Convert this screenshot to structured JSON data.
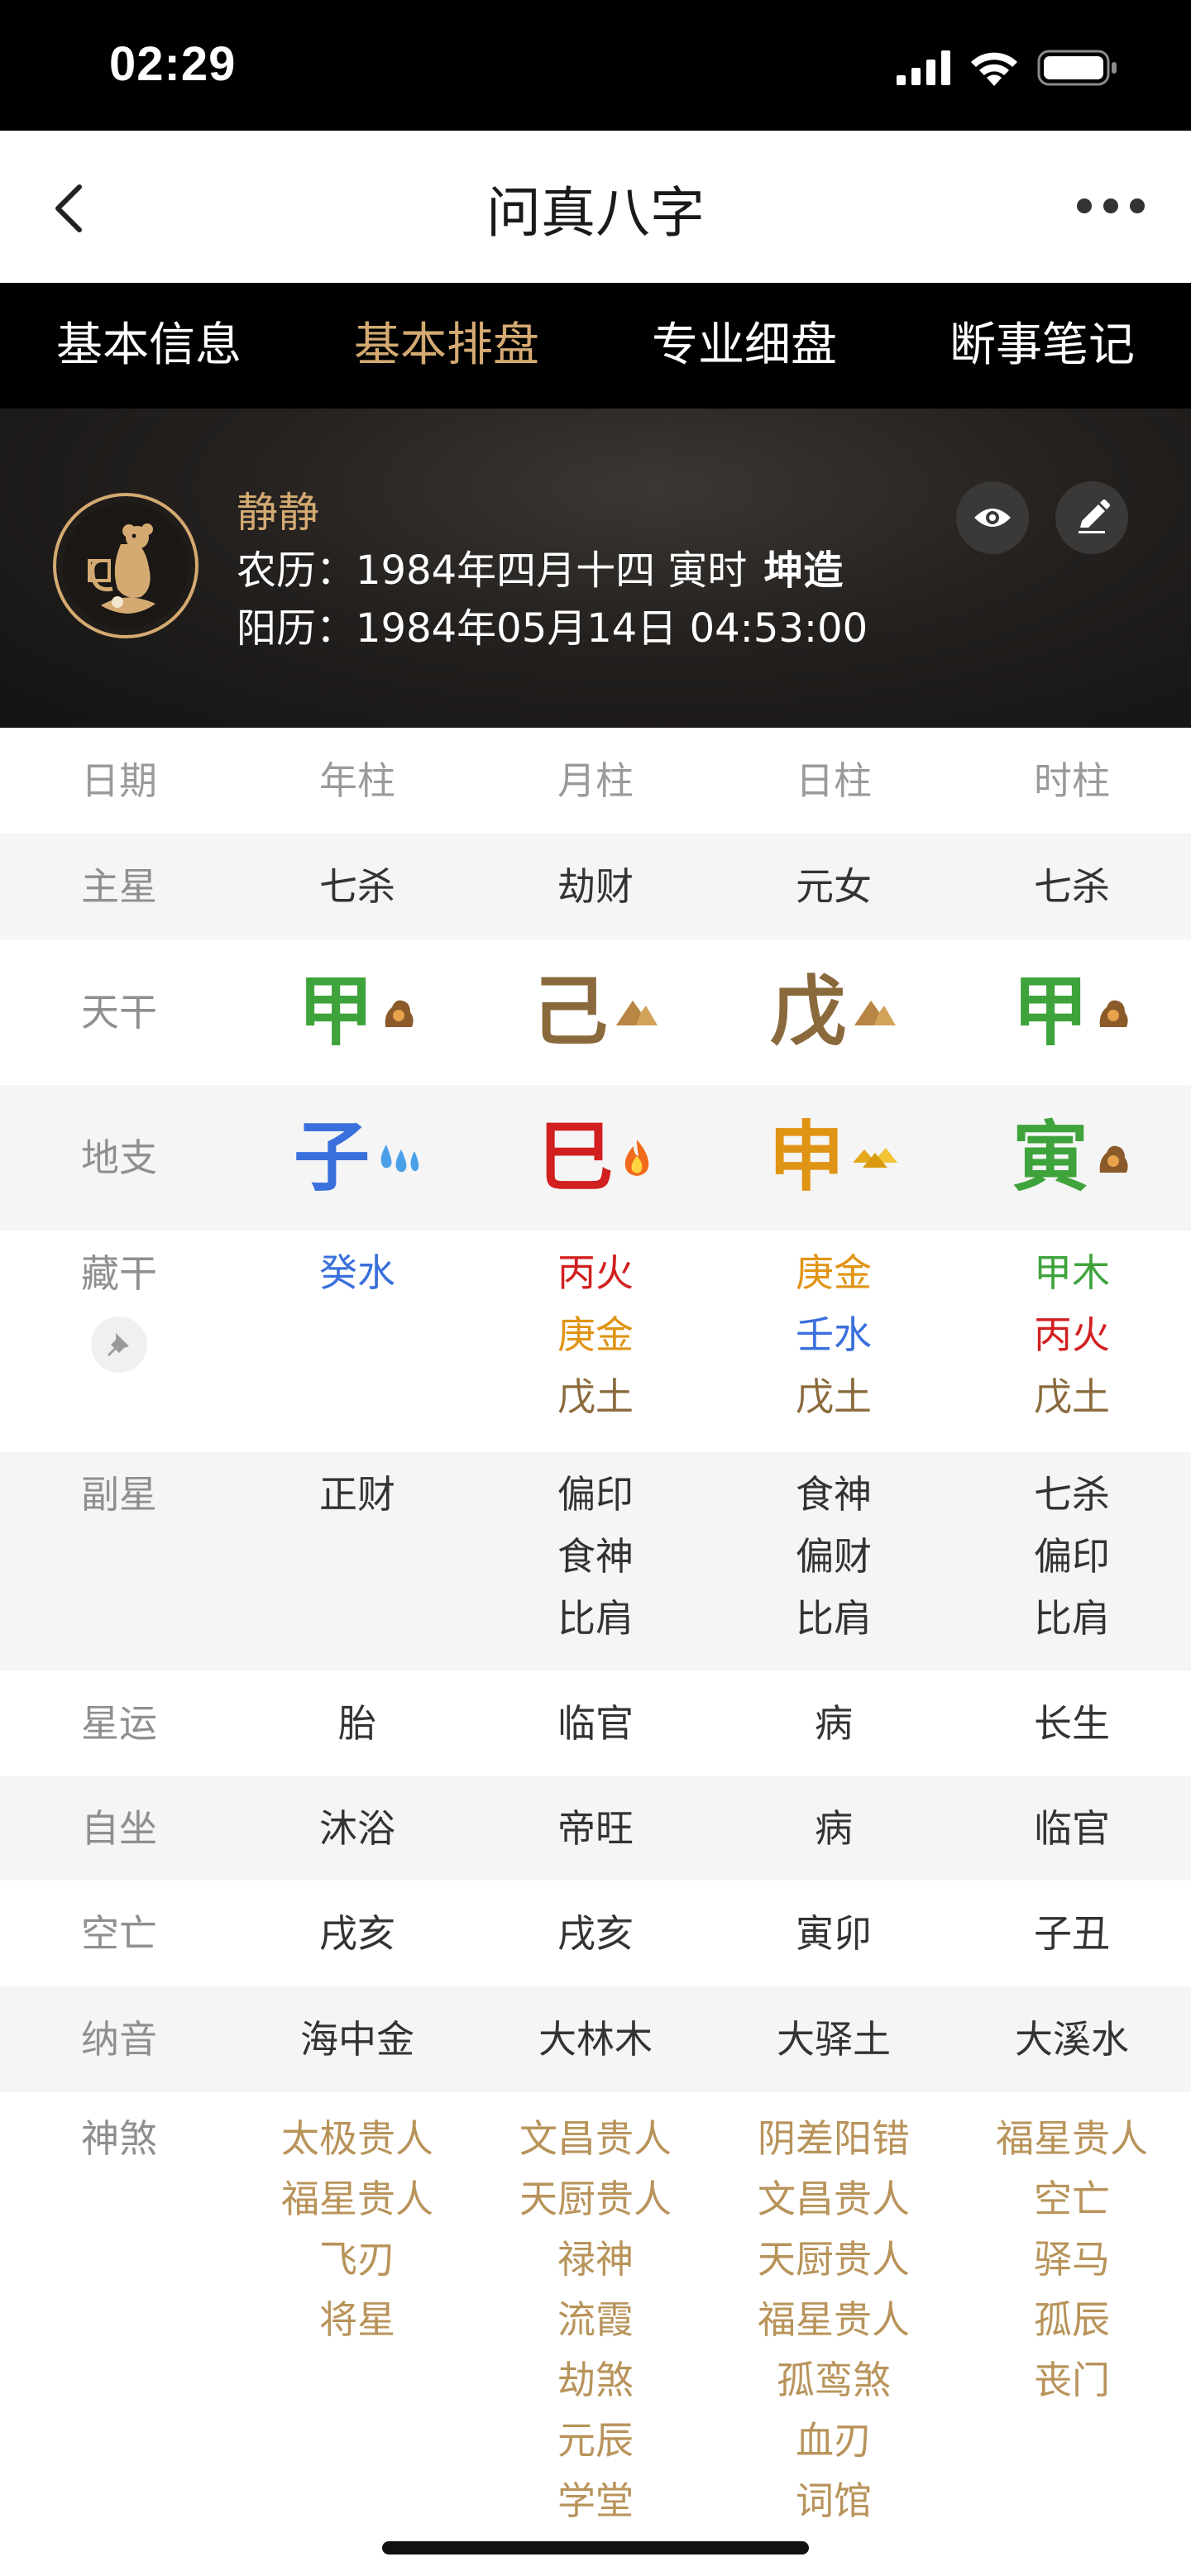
{
  "status_bar": {
    "time": "02:29"
  },
  "navbar": {
    "title": "问真八字"
  },
  "tabs": [
    "基本信息",
    "基本排盘",
    "专业细盘",
    "断事笔记"
  ],
  "active_tab": 1,
  "profile": {
    "name": "静静",
    "lunar_prefix": "农历：1984年四月十四 寅时",
    "gender_tag": "坤造",
    "solar": "阳历：1984年05月14日 04:53:00"
  },
  "table": {
    "columns": [
      "日期",
      "年柱",
      "月柱",
      "日柱",
      "时柱"
    ],
    "main_star": {
      "label": "主星",
      "values": [
        "七杀",
        "劫财",
        "元女",
        "七杀"
      ]
    },
    "heavenly_stems": {
      "label": "天干",
      "values": [
        {
          "char": "甲",
          "element": "wood"
        },
        {
          "char": "己",
          "element": "earth"
        },
        {
          "char": "戊",
          "element": "earth"
        },
        {
          "char": "甲",
          "element": "wood"
        }
      ]
    },
    "earthly_branches": {
      "label": "地支",
      "values": [
        {
          "char": "子",
          "element": "water"
        },
        {
          "char": "巳",
          "element": "fire"
        },
        {
          "char": "申",
          "element": "metal"
        },
        {
          "char": "寅",
          "element": "wood"
        }
      ]
    },
    "hidden_stems": {
      "label": "藏干",
      "values": [
        [
          {
            "text": "癸水",
            "element": "water"
          }
        ],
        [
          {
            "text": "丙火",
            "element": "fire"
          },
          {
            "text": "庚金",
            "element": "metal"
          },
          {
            "text": "戊土",
            "element": "earth"
          }
        ],
        [
          {
            "text": "庚金",
            "element": "metal"
          },
          {
            "text": "壬水",
            "element": "water"
          },
          {
            "text": "戊土",
            "element": "earth"
          }
        ],
        [
          {
            "text": "甲木",
            "element": "wood"
          },
          {
            "text": "丙火",
            "element": "fire"
          },
          {
            "text": "戊土",
            "element": "earth"
          }
        ]
      ]
    },
    "sub_stars": {
      "label": "副星",
      "values": [
        [
          "正财"
        ],
        [
          "偏印",
          "食神",
          "比肩"
        ],
        [
          "食神",
          "偏财",
          "比肩"
        ],
        [
          "七杀",
          "偏印",
          "比肩"
        ]
      ]
    },
    "star_luck": {
      "label": "星运",
      "values": [
        "胎",
        "临官",
        "病",
        "长生"
      ]
    },
    "self_seat": {
      "label": "自坐",
      "values": [
        "沐浴",
        "帝旺",
        "病",
        "临官"
      ]
    },
    "void": {
      "label": "空亡",
      "values": [
        "戌亥",
        "戌亥",
        "寅卯",
        "子丑"
      ]
    },
    "nayin": {
      "label": "纳音",
      "values": [
        "海中金",
        "大林木",
        "大驿土",
        "大溪水"
      ]
    },
    "shensha": {
      "label": "神煞",
      "values": [
        [
          "太极贵人",
          "福星贵人",
          "飞刃",
          "将星"
        ],
        [
          "文昌贵人",
          "天厨贵人",
          "禄神",
          "流霞",
          "劫煞",
          "元辰",
          "学堂"
        ],
        [
          "阴差阳错",
          "文昌贵人",
          "天厨贵人",
          "福星贵人",
          "孤鸾煞",
          "血刃",
          "词馆"
        ],
        [
          "福星贵人",
          "空亡",
          "驿马",
          "孤辰",
          "丧门"
        ]
      ]
    }
  },
  "element_colors": {
    "wood": "#3fa33c",
    "earth": "#8a6a3c",
    "water": "#3a70dc",
    "fire": "#d21f1f",
    "metal": "#e09414",
    "accent": "#d4aa72"
  }
}
